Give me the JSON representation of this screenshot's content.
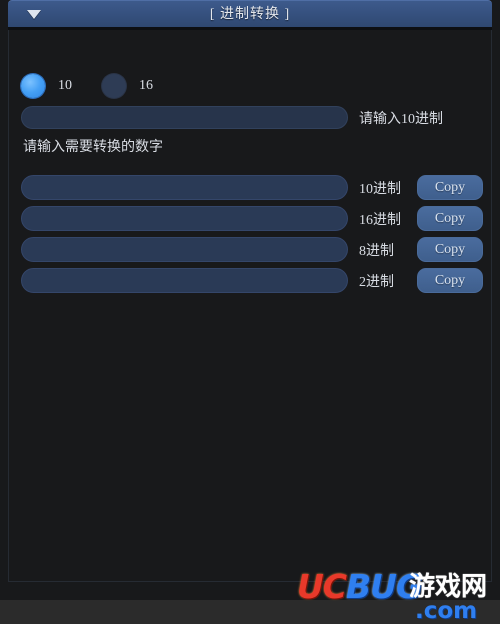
{
  "window": {
    "title": "[ 进制转换 ]",
    "menu_icon": "chevron-down-icon"
  },
  "base_selector": {
    "options": [
      {
        "label": "10",
        "selected": true
      },
      {
        "label": "16",
        "selected": false
      }
    ]
  },
  "input_section": {
    "value": "",
    "placeholder": "",
    "side_label": "请输入10进制",
    "hint": "请输入需要转换的数字"
  },
  "results": {
    "copy_label": "Copy",
    "rows": [
      {
        "label": "10进制",
        "value": ""
      },
      {
        "label": "16进制",
        "value": ""
      },
      {
        "label": "8进制",
        "value": ""
      },
      {
        "label": "2进制",
        "value": ""
      }
    ]
  },
  "watermark": {
    "uc": "UC",
    "bug": "BUG",
    "cn": "游戏网",
    "com": ".com"
  },
  "colors": {
    "titlebar": "#35507d",
    "background": "#18191b",
    "field": "#2a3a56",
    "accent": "#45a0f5",
    "button": "#4a6c9e"
  }
}
